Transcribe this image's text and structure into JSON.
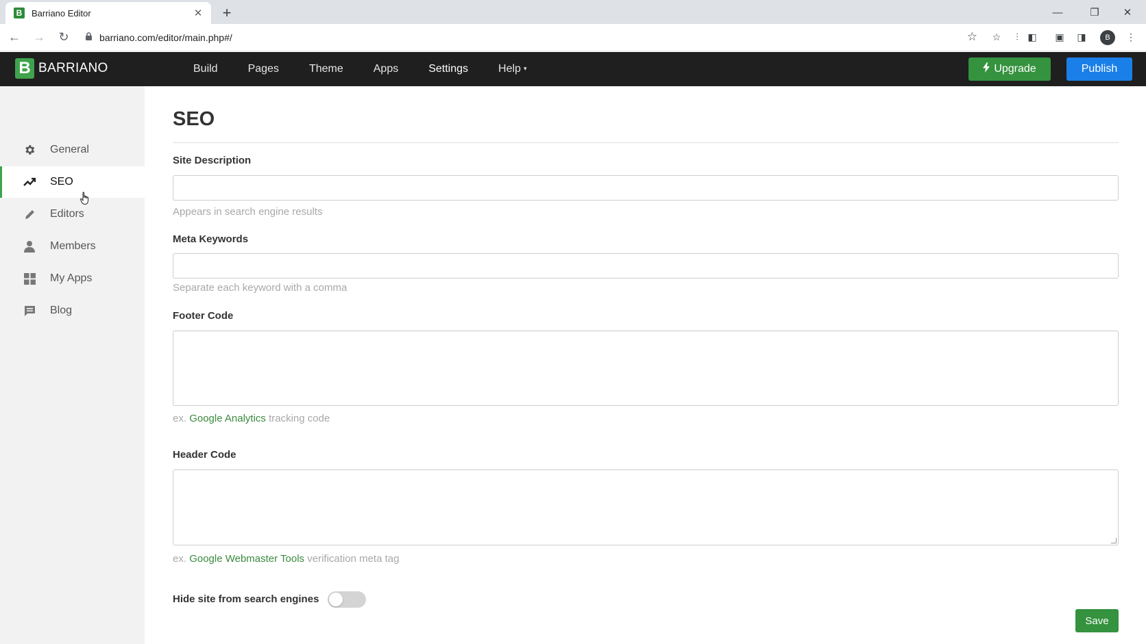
{
  "browser": {
    "tab_title": "Barriano Editor",
    "tab_favicon_letter": "B",
    "url": "barriano.com/editor/main.php#/",
    "profile_initial": "B"
  },
  "header": {
    "logo_letter": "B",
    "brand": "BARRIANO",
    "nav": [
      {
        "label": "Build"
      },
      {
        "label": "Pages"
      },
      {
        "label": "Theme"
      },
      {
        "label": "Apps"
      },
      {
        "label": "Settings",
        "active": true
      },
      {
        "label": "Help"
      }
    ],
    "upgrade_label": "Upgrade",
    "publish_label": "Publish",
    "colors": {
      "bar": "#1f1f1f",
      "upgrade": "#35923e",
      "publish": "#1a7fe8"
    }
  },
  "sidebar": {
    "items": [
      {
        "label": "General",
        "icon": "gear-icon"
      },
      {
        "label": "SEO",
        "icon": "trending-up-icon",
        "active": true
      },
      {
        "label": "Editors",
        "icon": "pencil-icon"
      },
      {
        "label": "Members",
        "icon": "user-icon"
      },
      {
        "label": "My Apps",
        "icon": "grid-icon"
      },
      {
        "label": "Blog",
        "icon": "comment-icon"
      }
    ],
    "accent": "#3fa34d"
  },
  "seo": {
    "title": "SEO",
    "site_description": {
      "label": "Site Description",
      "value": "",
      "help": "Appears in search engine results"
    },
    "meta_keywords": {
      "label": "Meta Keywords",
      "value": "",
      "help": "Separate each keyword with a comma"
    },
    "footer_code": {
      "label": "Footer Code",
      "value": "",
      "help_prefix": "ex.",
      "help_link": "Google Analytics",
      "help_suffix": "tracking code"
    },
    "header_code": {
      "label": "Header Code",
      "value": "",
      "help_prefix": "ex.",
      "help_link": "Google Webmaster Tools",
      "help_suffix": "verification meta tag"
    },
    "hide_label": "Hide site from search engines",
    "hide_enabled": false,
    "save_label": "Save"
  }
}
